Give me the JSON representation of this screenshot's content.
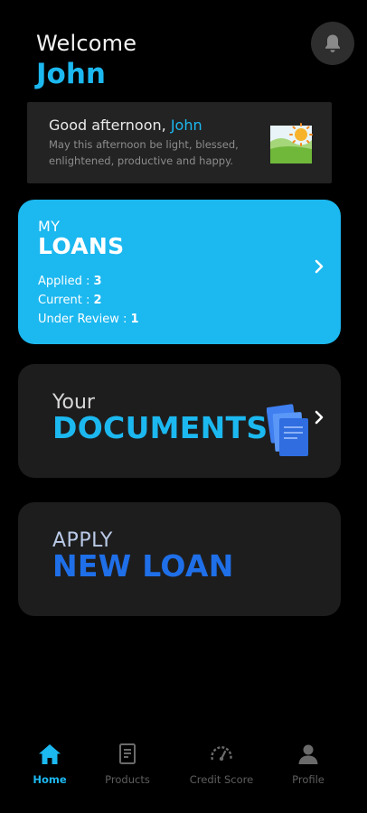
{
  "header": {
    "welcome": "Welcome",
    "username": "John"
  },
  "greeting": {
    "prefix": "Good afternoon, ",
    "name": "John",
    "message": "May this afternoon be light, blessed, enlightened, productive and happy."
  },
  "loans_card": {
    "kicker": "MY",
    "title": "LOANS",
    "applied_label": "Applied : ",
    "applied_value": "3",
    "current_label": "Current : ",
    "current_value": "2",
    "review_label": "Under Review : ",
    "review_value": "1"
  },
  "documents_card": {
    "kicker": "Your",
    "title": "DOCUMENTS"
  },
  "apply_card": {
    "kicker": "APPLY",
    "title": "NEW LOAN"
  },
  "tabs": [
    {
      "label": "Home",
      "icon": "home-icon",
      "active": true
    },
    {
      "label": "Products",
      "icon": "document-icon",
      "active": false
    },
    {
      "label": "Credit Score",
      "icon": "gauge-icon",
      "active": false
    },
    {
      "label": "Profile",
      "icon": "person-icon",
      "active": false
    }
  ],
  "icons": {
    "notifications": "bell-icon",
    "greeting": "sun-landscape-icon",
    "documents": "documents-stack-icon",
    "chevron": "chevron-right-icon"
  },
  "colors": {
    "accent": "#1cb8f0",
    "apply_accent": "#1f6fe8",
    "card_dark": "#1d1d1d",
    "background": "#000000"
  }
}
